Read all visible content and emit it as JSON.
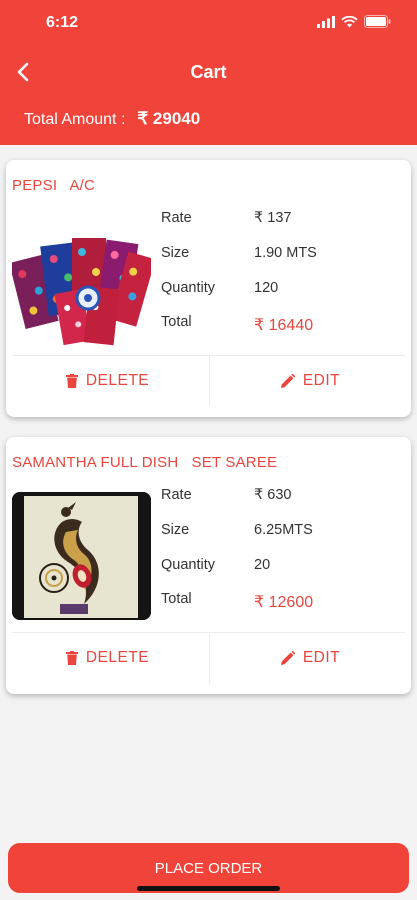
{
  "status_bar": {
    "time": "6:12"
  },
  "header": {
    "title": "Cart",
    "total_label": "Total Amount :",
    "total_value": "₹ 29040"
  },
  "items": [
    {
      "name": "PEPSI   A/C",
      "rate_label": "Rate",
      "rate": "₹ 137",
      "size_label": "Size",
      "size": "1.90 MTS",
      "qty_label": "Quantity",
      "qty": "120",
      "total_label": "Total",
      "total": "₹ 16440",
      "delete_label": "DELETE",
      "edit_label": "EDIT"
    },
    {
      "name": "SAMANTHA FULL DISH   SET SAREE",
      "rate_label": "Rate",
      "rate": "₹ 630",
      "size_label": "Size",
      "size": "6.25MTS",
      "qty_label": "Quantity",
      "qty": "20",
      "total_label": "Total",
      "total": "₹ 12600",
      "delete_label": "DELETE",
      "edit_label": "EDIT"
    }
  ],
  "footer": {
    "place_order_label": "PLACE ORDER"
  },
  "colors": {
    "accent": "#f0433a",
    "text_red": "#e8463e"
  },
  "icons": [
    "back-chevron-icon",
    "signal-icon",
    "wifi-icon",
    "battery-icon",
    "trash-icon",
    "pencil-icon"
  ]
}
